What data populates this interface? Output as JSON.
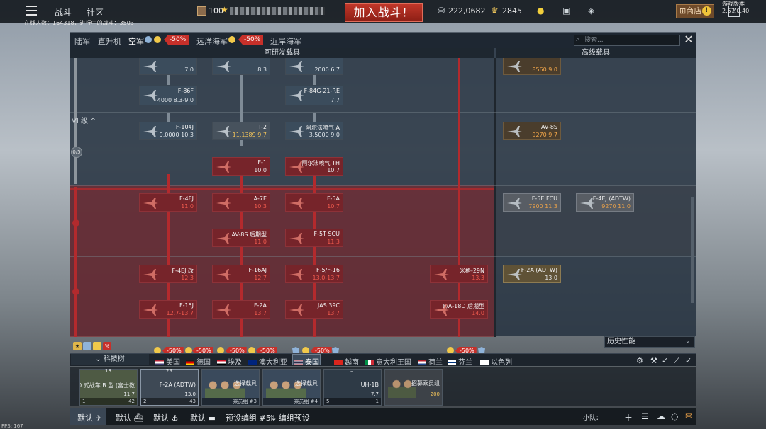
{
  "topbar": {
    "battles_tab": "战斗",
    "community_tab": "社区",
    "player_level": "100",
    "battle_button": "加入战斗！",
    "silver_lions": "222,0682",
    "golden_eagles": "2845",
    "shop_label": "商店",
    "help_label": "?",
    "version": "游戏版本 2.57.0.40",
    "online_info": "在线人数：164318，进行中的战斗：3503"
  },
  "branch_tabs": [
    {
      "label": "陆军",
      "active": false
    },
    {
      "label": "直升机",
      "active": false
    },
    {
      "label": "空军",
      "active": true,
      "sale": "-50%"
    },
    {
      "label": "远洋海军",
      "active": false,
      "sale": "-50%"
    },
    {
      "label": "近岸海军",
      "active": false
    }
  ],
  "search": {
    "placeholder": "搜索..."
  },
  "columns": {
    "main": "可研发载具",
    "premium": "高级载具"
  },
  "rank": {
    "label": "VI 级",
    "progress": "0/5"
  },
  "vehicles": {
    "c1_top": {
      "name": "",
      "br": "7.0"
    },
    "c2_top": {
      "name": "",
      "br": "8.3"
    },
    "c3_top": {
      "name": "",
      "br": "2000 6.7"
    },
    "p1_top": {
      "name": "",
      "br": "8560 9.0"
    },
    "f86f": {
      "name": "F-86F",
      "br": "4000 8.3-9.0"
    },
    "f84g": {
      "name": "F-84G-21-RE",
      "br": "7.7"
    },
    "f104j": {
      "name": "F-104J",
      "br": "9,0000 10.3"
    },
    "t2": {
      "name": "T-2",
      "br": "11,1389 9.7"
    },
    "alpha_a": {
      "name": "阿尔法喷气 A",
      "br": "3,5000 9.0"
    },
    "av8s": {
      "name": "AV-8S",
      "br": "9270 9.7"
    },
    "f1": {
      "name": "F-1",
      "br": "10.0"
    },
    "alpha_th": {
      "name": "阿尔法喷气 TH",
      "br": "10.7"
    },
    "f4ej": {
      "name": "F-4EJ",
      "br": "11.0"
    },
    "a7e": {
      "name": "A-7E",
      "br": "10.3"
    },
    "f5a": {
      "name": "F-5A",
      "br": "10.7"
    },
    "f5e_fcu": {
      "name": "F-5E FCU",
      "br": "7900 11.3"
    },
    "f4ej_adtw": {
      "name": "F-4EJ (ADTW)",
      "br": "9270 11.0"
    },
    "av8s_late": {
      "name": "AV-8S 后期型",
      "br": "11.0"
    },
    "f5t_scu": {
      "name": "F-5T SCU",
      "br": "11.3"
    },
    "f4ej_kai": {
      "name": "F-4EJ 改",
      "br": "12.3"
    },
    "f16aj": {
      "name": "F-16AJ",
      "br": "12.7"
    },
    "f5f16": {
      "name": "F-5/F-16",
      "br": "13.0-13.7"
    },
    "mig29n": {
      "name": "米格-29N",
      "br": "13.3"
    },
    "f2a_adtw": {
      "name": "F-2A (ADTW)",
      "br": "13.0"
    },
    "f15j": {
      "name": "F-15J",
      "br": "12.7-13.7"
    },
    "f2a": {
      "name": "F-2A",
      "br": "13.7"
    },
    "jas39c": {
      "name": "JAS 39C",
      "br": "13.7"
    },
    "fa18d": {
      "name": "F/A-18D 后期型",
      "br": "14.0"
    }
  },
  "history_select": "历史性能",
  "tech_tree_button": "科技树",
  "nations": [
    {
      "label": "美国",
      "colors": [
        "#b22234",
        "#ffffff",
        "#3c3b6e"
      ]
    },
    {
      "label": "德国",
      "colors": [
        "#1a1a1a",
        "#dd0000",
        "#ffce00"
      ]
    },
    {
      "label": "埃及",
      "colors": [
        "#ce1126",
        "#ffffff",
        "#000000"
      ]
    },
    {
      "label": "澳大利亚",
      "colors": [
        "#00247d",
        "#cf142b",
        "#ffffff"
      ]
    },
    {
      "label": "泰国",
      "colors": [
        "#a51931",
        "#f4f5f8",
        "#2d2a4a"
      ]
    },
    {
      "label": "越南",
      "colors": [
        "#da251d",
        "#ffcd00",
        "#da251d"
      ]
    },
    {
      "label": "意大利王国",
      "colors": [
        "#009246",
        "#ffffff",
        "#ce2b37"
      ]
    },
    {
      "label": "荷兰",
      "colors": [
        "#ae1c28",
        "#ffffff",
        "#21468b"
      ]
    },
    {
      "label": "芬兰",
      "colors": [
        "#ffffff",
        "#003580",
        "#ffffff"
      ]
    },
    {
      "label": "以色列",
      "colors": [
        "#ffffff",
        "#0038b8",
        "#ffffff"
      ]
    }
  ],
  "sale_badges": {
    "a": "-50%",
    "b": "-50%",
    "c": "-50%",
    "d": "-50%",
    "e": "-50%",
    "f": "-50%"
  },
  "crew_slots": [
    {
      "top": "13",
      "name": "90 式战车 B 型 (富士教",
      "br": "11.7",
      "foot_left": "1",
      "foot_right": "42"
    },
    {
      "top": "29",
      "name": "F-2A (ADTW)",
      "br": "13.0",
      "foot_left": "2",
      "foot_right": "43"
    },
    {
      "top": "",
      "name": "选择载具",
      "br": "",
      "foot_left": "",
      "foot_right": "乘员组 #3"
    },
    {
      "top": "",
      "name": "选择载具",
      "br": "",
      "foot_left": "",
      "foot_right": "乘员组 #4"
    },
    {
      "top": "–",
      "name": "UH-1B",
      "br": "7.7",
      "foot_left": "5",
      "foot_right": "1"
    },
    {
      "top": "",
      "name": "招募乘员组",
      "br": "200",
      "foot_left": "",
      "foot_right": ""
    }
  ],
  "presets": {
    "p1": "默认",
    "p2": "默认",
    "p3": "默认",
    "p4": "默认",
    "p5": "预设编组 #5",
    "p6": "编组预设"
  },
  "squad_label": "小队：",
  "fps": "FPS: 167",
  "colors": {
    "accent_red": "#c7302a",
    "researched_card": "#3b4c5c",
    "locked_card": "#76242a",
    "premium_card": "#4a3d2c",
    "gold": "#f2c64a"
  }
}
